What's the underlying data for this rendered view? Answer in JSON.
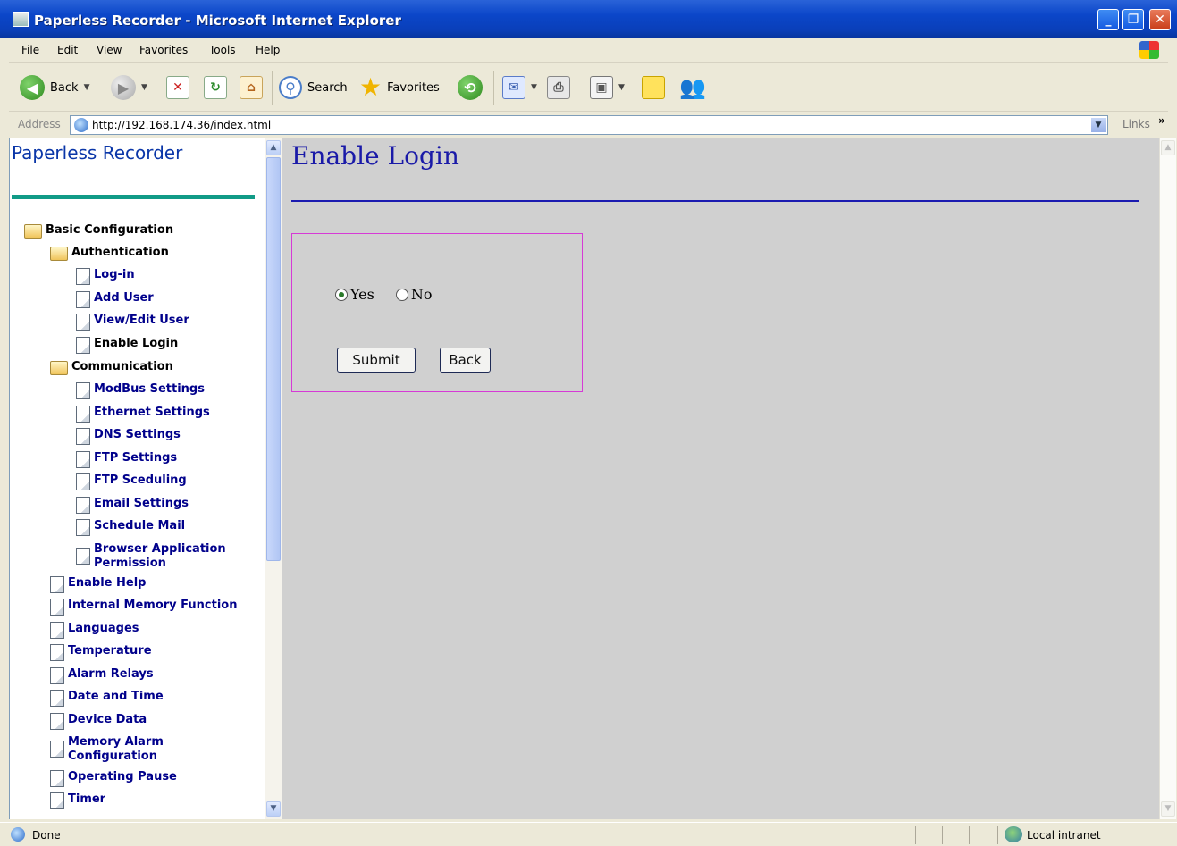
{
  "window": {
    "title": "Paperless Recorder - Microsoft Internet Explorer",
    "controls": [
      "_",
      "❐",
      "✕"
    ]
  },
  "menubar": {
    "items": [
      "File",
      "Edit",
      "View",
      "Favorites",
      "Tools",
      "Help"
    ]
  },
  "toolbar": {
    "back_label": "Back",
    "search_label": "Search",
    "favorites_label": "Favorites"
  },
  "address": {
    "label": "Address",
    "url": "http://192.168.174.36/index.html",
    "links_label": "Links",
    "links_chevron": "»"
  },
  "sidebar": {
    "brand": "Paperless Recorder",
    "tree": [
      {
        "label": "Basic Configuration",
        "type": "folder",
        "level": 0
      },
      {
        "label": "Authentication",
        "type": "folder",
        "level": 1
      },
      {
        "label": "Log-in",
        "type": "page",
        "level": 2
      },
      {
        "label": "Add User",
        "type": "page",
        "level": 2
      },
      {
        "label": "View/Edit User",
        "type": "page",
        "level": 2
      },
      {
        "label": "Enable Login",
        "type": "page",
        "level": 2,
        "current": true
      },
      {
        "label": "Communication",
        "type": "folder",
        "level": 1
      },
      {
        "label": "ModBus Settings",
        "type": "page",
        "level": 2
      },
      {
        "label": "Ethernet Settings",
        "type": "page",
        "level": 2
      },
      {
        "label": "DNS Settings",
        "type": "page",
        "level": 2
      },
      {
        "label": "FTP Settings",
        "type": "page",
        "level": 2
      },
      {
        "label": "FTP Sceduling",
        "type": "page",
        "level": 2
      },
      {
        "label": "Email Settings",
        "type": "page",
        "level": 2
      },
      {
        "label": "Schedule Mail",
        "type": "page",
        "level": 2
      },
      {
        "label": "Browser Application Permission",
        "type": "page",
        "level": 2
      },
      {
        "label": "Enable Help",
        "type": "page",
        "level": 1
      },
      {
        "label": "Internal Memory Function",
        "type": "page",
        "level": 1
      },
      {
        "label": "Languages",
        "type": "page",
        "level": 1
      },
      {
        "label": "Temperature",
        "type": "page",
        "level": 1
      },
      {
        "label": "Alarm Relays",
        "type": "page",
        "level": 1
      },
      {
        "label": "Date and Time",
        "type": "page",
        "level": 1
      },
      {
        "label": "Device Data",
        "type": "page",
        "level": 1
      },
      {
        "label": "Memory Alarm Configuration",
        "type": "page",
        "level": 1
      },
      {
        "label": "Operating Pause",
        "type": "page",
        "level": 1
      },
      {
        "label": "Timer",
        "type": "page",
        "level": 1
      }
    ]
  },
  "main": {
    "title": "Enable Login",
    "options": [
      {
        "label": "Yes",
        "checked": true
      },
      {
        "label": "No",
        "checked": false
      }
    ],
    "submit_label": "Submit",
    "back_label": "Back"
  },
  "statusbar": {
    "status": "Done",
    "zone": "Local intranet"
  },
  "colors": {
    "nav_link": "#00008b",
    "title_blue": "#1a1aa8",
    "brand_rule": "#119b87",
    "form_border": "#d63ad6",
    "right_bg": "#d0d0d0"
  }
}
